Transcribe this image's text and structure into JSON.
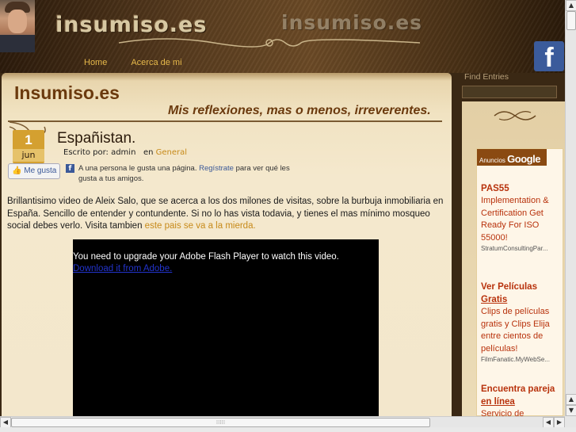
{
  "header": {
    "logo_text": "insumiso.es",
    "logo_ghost": "insumiso.es",
    "nav": [
      "Home",
      "Acerca de mi"
    ],
    "facebook_icon": "f"
  },
  "site": {
    "title": "Insumiso.es",
    "tagline": "Mis reflexiones, mas o menos, irreverentes."
  },
  "post": {
    "date_day": "1",
    "date_month": "jun",
    "title": "Españistan.",
    "author_prefix": "Escrito por: admin",
    "category_prefix": "en",
    "category": "General",
    "like_button": "Me gusta",
    "like_text_1": "A una persona le gusta una página.",
    "like_register": "Regístrate",
    "like_text_2": "para ver qué les gusta a tus amigos.",
    "body": "Brillantisimo video de Aleix Salo, que se acerca a los dos milones de visitas, sobre la burbuja inmobiliaria en España. Sencillo de entender y contundente. Si no lo has vista todavia, y tienes el mas mínimo mosqueo social debes verlo.  Visita tambien",
    "body_link": "este pais se va a la mierda.",
    "video_message": "You need to upgrade your Adobe Flash Player to watch this video.",
    "video_link": "Download it from Adobe."
  },
  "sidebar": {
    "find_label": "Find Entries",
    "ads_label": "Anuncios",
    "ads_brand": "Google",
    "ads": [
      {
        "title": "PAS55",
        "text": "Implementation & Certification Get Ready For ISO 55000!",
        "url": "StratumConsultingPar..."
      },
      {
        "title_a": "Ver Películas",
        "title_b": "Gratis",
        "text": "Clips de películas gratis y Clips Elija entre cientos de películas!",
        "url": "FilmFanatic.MyWebSe..."
      },
      {
        "title_a": "Encuentra pareja",
        "title_b": "en línea",
        "text": "Servicio de"
      }
    ]
  },
  "colors": {
    "accent": "#c78a1a",
    "title": "#6b3a0e",
    "badge": "#d4a030",
    "ad_text": "#b8320c",
    "facebook": "#3b5998"
  }
}
